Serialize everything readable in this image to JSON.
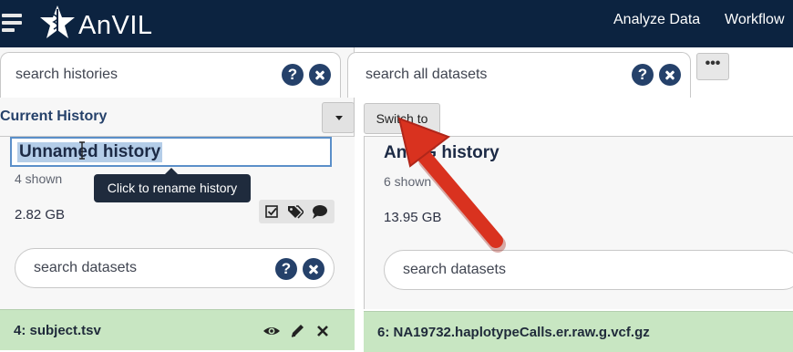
{
  "header": {
    "brand": "AnVIL",
    "nav": [
      "Analyze Data",
      "Workflow"
    ]
  },
  "left_panel": {
    "search_placeholder": "search histories",
    "section_title": "Current History",
    "history_name": "Unnamed history",
    "shown": "4 shown",
    "size": "2.82 GB",
    "tooltip": "Click to rename history",
    "dataset_search_placeholder": "search datasets",
    "datasets": [
      {
        "title": "4: subject.tsv"
      }
    ]
  },
  "right_panel": {
    "search_placeholder": "search all datasets",
    "switch_button": "Switch to",
    "more_button": "•••",
    "history_name": "AnVIG history",
    "shown": "6 shown",
    "size": "13.95 GB",
    "dataset_search_placeholder": "search datasets",
    "datasets": [
      {
        "title": "6: NA19732.haplotypeCalls.er.raw.g.vcf.gz"
      }
    ]
  },
  "icons": {
    "help": "?",
    "colors": {
      "navy": "#0c2340",
      "accent": "#25416a",
      "dataset_ok": "#c8e6c2",
      "arrow": "#d9321f"
    }
  }
}
